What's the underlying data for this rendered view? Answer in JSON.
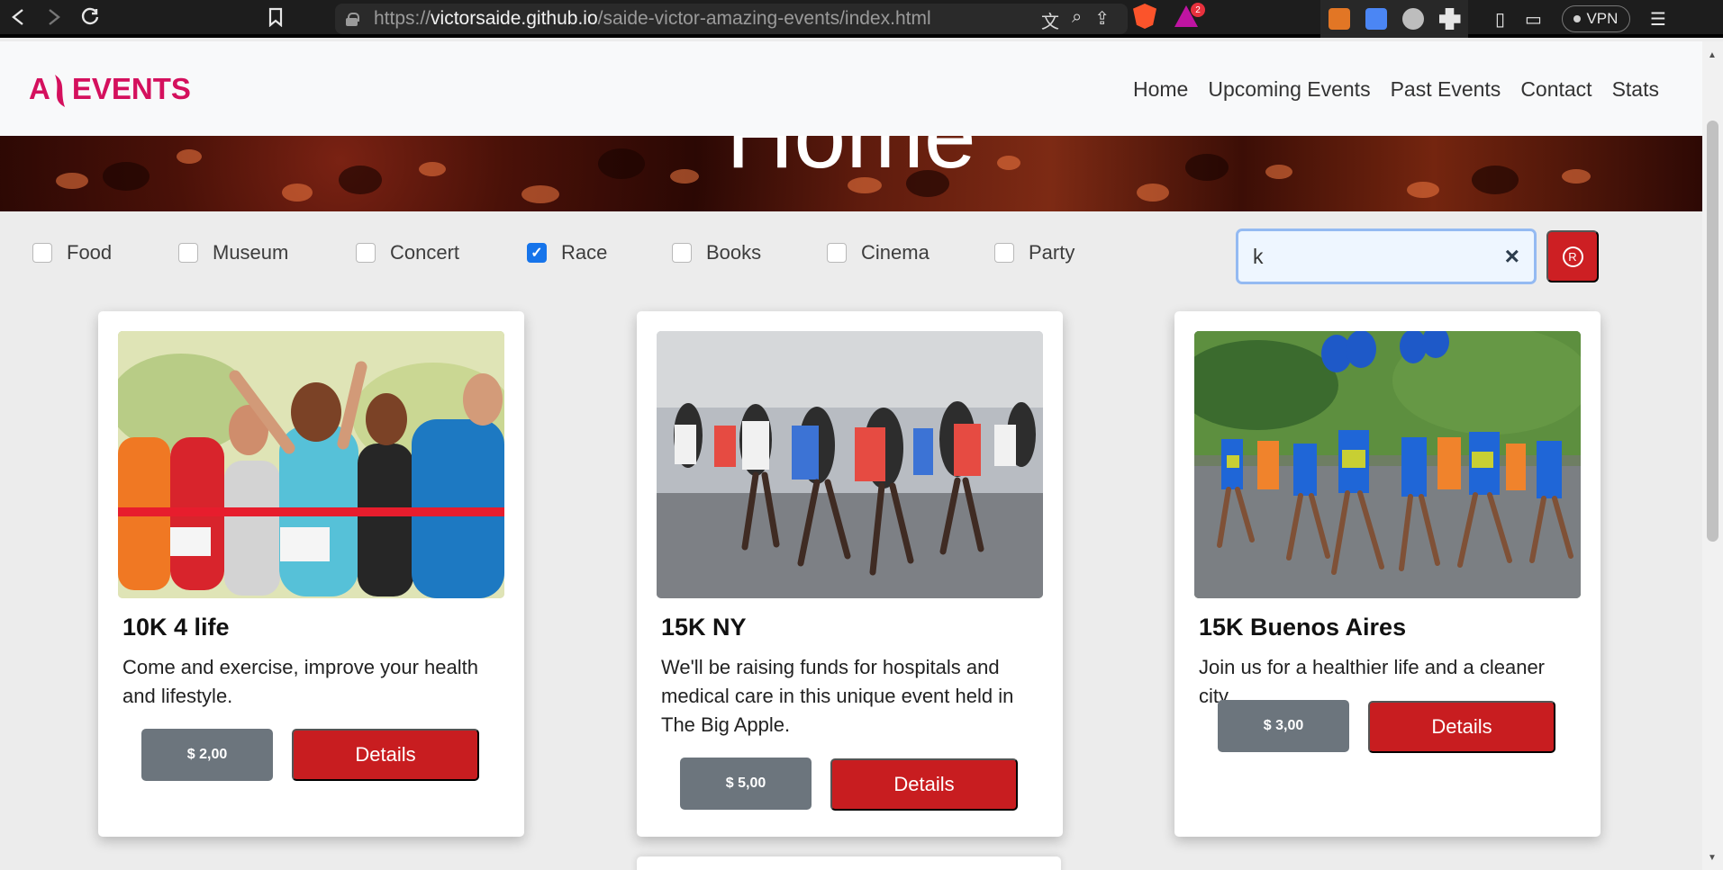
{
  "browser": {
    "url_host": "victorsaide.github.io",
    "url_path": "/saide-victor-amazing-events/index.html",
    "url_scheme": "https://",
    "rewards_count": "2",
    "vpn_label": "VPN"
  },
  "brand": {
    "logo_text": "EVENTS",
    "logo_initial": "A"
  },
  "nav": {
    "links": [
      "Home",
      "Upcoming Events",
      "Past Events",
      "Contact",
      "Stats"
    ]
  },
  "hero": {
    "title": "Home"
  },
  "filters": [
    {
      "label": "Food",
      "checked": false
    },
    {
      "label": "Museum",
      "checked": false
    },
    {
      "label": "Concert",
      "checked": false
    },
    {
      "label": "Race",
      "checked": true
    },
    {
      "label": "Books",
      "checked": false
    },
    {
      "label": "Cinema",
      "checked": false
    },
    {
      "label": "Party",
      "checked": false
    }
  ],
  "search": {
    "value": "k"
  },
  "cards": [
    {
      "title": "10K 4 life",
      "description": "Come and exercise, improve your health and lifestyle.",
      "price": "$ 2,00",
      "details_label": "Details"
    },
    {
      "title": "15K NY",
      "description": "We'll be raising funds for hospitals and medical care in this unique event held in The Big Apple.",
      "price": "$ 5,00",
      "details_label": "Details"
    },
    {
      "title": "15K Buenos Aires",
      "description": "Join us for a healthier life and a cleaner city.",
      "price": "$ 3,00",
      "details_label": "Details"
    }
  ],
  "colors": {
    "brand": "#d4105d",
    "action": "#c81d20",
    "checked": "#1674ea",
    "price": "#6c757d"
  }
}
